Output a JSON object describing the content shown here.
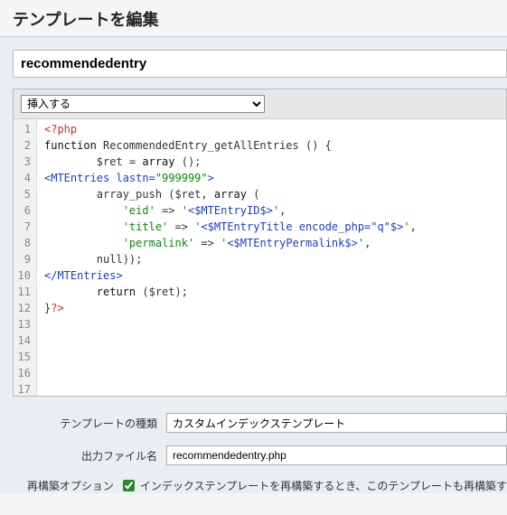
{
  "page_title": "テンプレートを編集",
  "template_name_value": "recommendedentry",
  "insert_select": {
    "selected": "挿入する"
  },
  "code_lines": [
    [
      {
        "t": "<?php",
        "c": "php"
      }
    ],
    [
      {
        "t": "function",
        "c": "kw"
      },
      {
        "t": " RecommendedEntry_getAllEntries () {",
        "c": ""
      }
    ],
    [
      {
        "t": "        $ret = ",
        "c": ""
      },
      {
        "t": "array",
        "c": "kw"
      },
      {
        "t": " ();",
        "c": ""
      }
    ],
    [
      {
        "t": "<MTEntries",
        "c": "tag"
      },
      {
        "t": " lastn=",
        "c": "attr"
      },
      {
        "t": "\"999999\"",
        "c": "str"
      },
      {
        "t": ">",
        "c": "tag"
      }
    ],
    [
      {
        "t": "        array_push ($ret, ",
        "c": ""
      },
      {
        "t": "array",
        "c": "kw"
      },
      {
        "t": " (",
        "c": ""
      }
    ],
    [
      {
        "t": "            ",
        "c": ""
      },
      {
        "t": "'eid'",
        "c": "str"
      },
      {
        "t": " => ",
        "c": ""
      },
      {
        "t": "'",
        "c": "str"
      },
      {
        "t": "<$MTEntryID$>",
        "c": "tag"
      },
      {
        "t": "'",
        "c": "str"
      },
      {
        "t": ",",
        "c": ""
      }
    ],
    [
      {
        "t": "            ",
        "c": ""
      },
      {
        "t": "'title'",
        "c": "str"
      },
      {
        "t": " => ",
        "c": ""
      },
      {
        "t": "'",
        "c": "str"
      },
      {
        "t": "<$MTEntryTitle encode_php=\"q\"$>",
        "c": "tag"
      },
      {
        "t": "'",
        "c": "str"
      },
      {
        "t": ",",
        "c": ""
      }
    ],
    [
      {
        "t": "            ",
        "c": ""
      },
      {
        "t": "'permalink'",
        "c": "str"
      },
      {
        "t": " => ",
        "c": ""
      },
      {
        "t": "'",
        "c": "str"
      },
      {
        "t": "<$MTEntryPermalink$>",
        "c": "tag"
      },
      {
        "t": "'",
        "c": "str"
      },
      {
        "t": ",",
        "c": ""
      }
    ],
    [
      {
        "t": "        null));",
        "c": ""
      }
    ],
    [
      {
        "t": "</MTEntries>",
        "c": "tag"
      }
    ],
    [
      {
        "t": "        ",
        "c": ""
      },
      {
        "t": "return",
        "c": "kw"
      },
      {
        "t": " ($ret);",
        "c": ""
      }
    ],
    [
      {
        "t": "}",
        "c": ""
      },
      {
        "t": "?>",
        "c": "php"
      }
    ],
    [
      {
        "t": "",
        "c": ""
      }
    ],
    [
      {
        "t": "",
        "c": ""
      }
    ],
    [
      {
        "t": "",
        "c": ""
      }
    ],
    [
      {
        "t": "",
        "c": ""
      }
    ],
    [
      {
        "t": "",
        "c": ""
      }
    ]
  ],
  "fields": {
    "template_type_label": "テンプレートの種類",
    "template_type_value": "カスタムインデックステンプレート",
    "output_file_label": "出力ファイル名",
    "output_file_value": "recommendedentry.php",
    "rebuild_option_label": "再構築オプション",
    "rebuild_checkbox_checked": true,
    "rebuild_checkbox_text": "インデックステンプレートを再構築するとき、このテンプレートも再構築す"
  }
}
